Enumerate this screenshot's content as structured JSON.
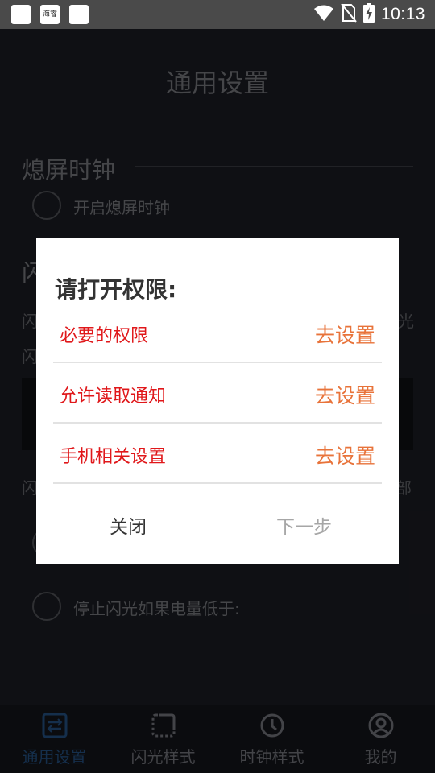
{
  "status_bar": {
    "app_icon_text": "海睿",
    "time": "10:13"
  },
  "page": {
    "title": "通用设置",
    "section1_title": "熄屏时钟",
    "option_enable_clock": "开启熄屏时钟",
    "section2_title_partial": "闪",
    "partial_left_1": "闪",
    "partial_left_2": "闪",
    "partial_right_1": "光",
    "partial_left_3": "闪",
    "partial_right_3": "部",
    "option_stop_flash": "停止闪光如果电量低于:"
  },
  "dialog": {
    "title": "请打开权限:",
    "rows": [
      {
        "name": "必要的权限",
        "action": "去设置"
      },
      {
        "name": "允许读取通知",
        "action": "去设置"
      },
      {
        "name": "手机相关设置",
        "action": "去设置"
      }
    ],
    "close_label": "关闭",
    "next_label": "下一步"
  },
  "bottom_nav": {
    "items": [
      {
        "label": "通用设置",
        "icon": "settings-sliders-icon",
        "active": true
      },
      {
        "label": "闪光样式",
        "icon": "dotted-frame-icon",
        "active": false
      },
      {
        "label": "时钟样式",
        "icon": "clock-icon",
        "active": false
      },
      {
        "label": "我的",
        "icon": "user-icon",
        "active": false
      }
    ]
  },
  "colors": {
    "accent_active": "#1c3f66",
    "permission_red": "#e0171a",
    "action_orange": "#e8733a"
  }
}
